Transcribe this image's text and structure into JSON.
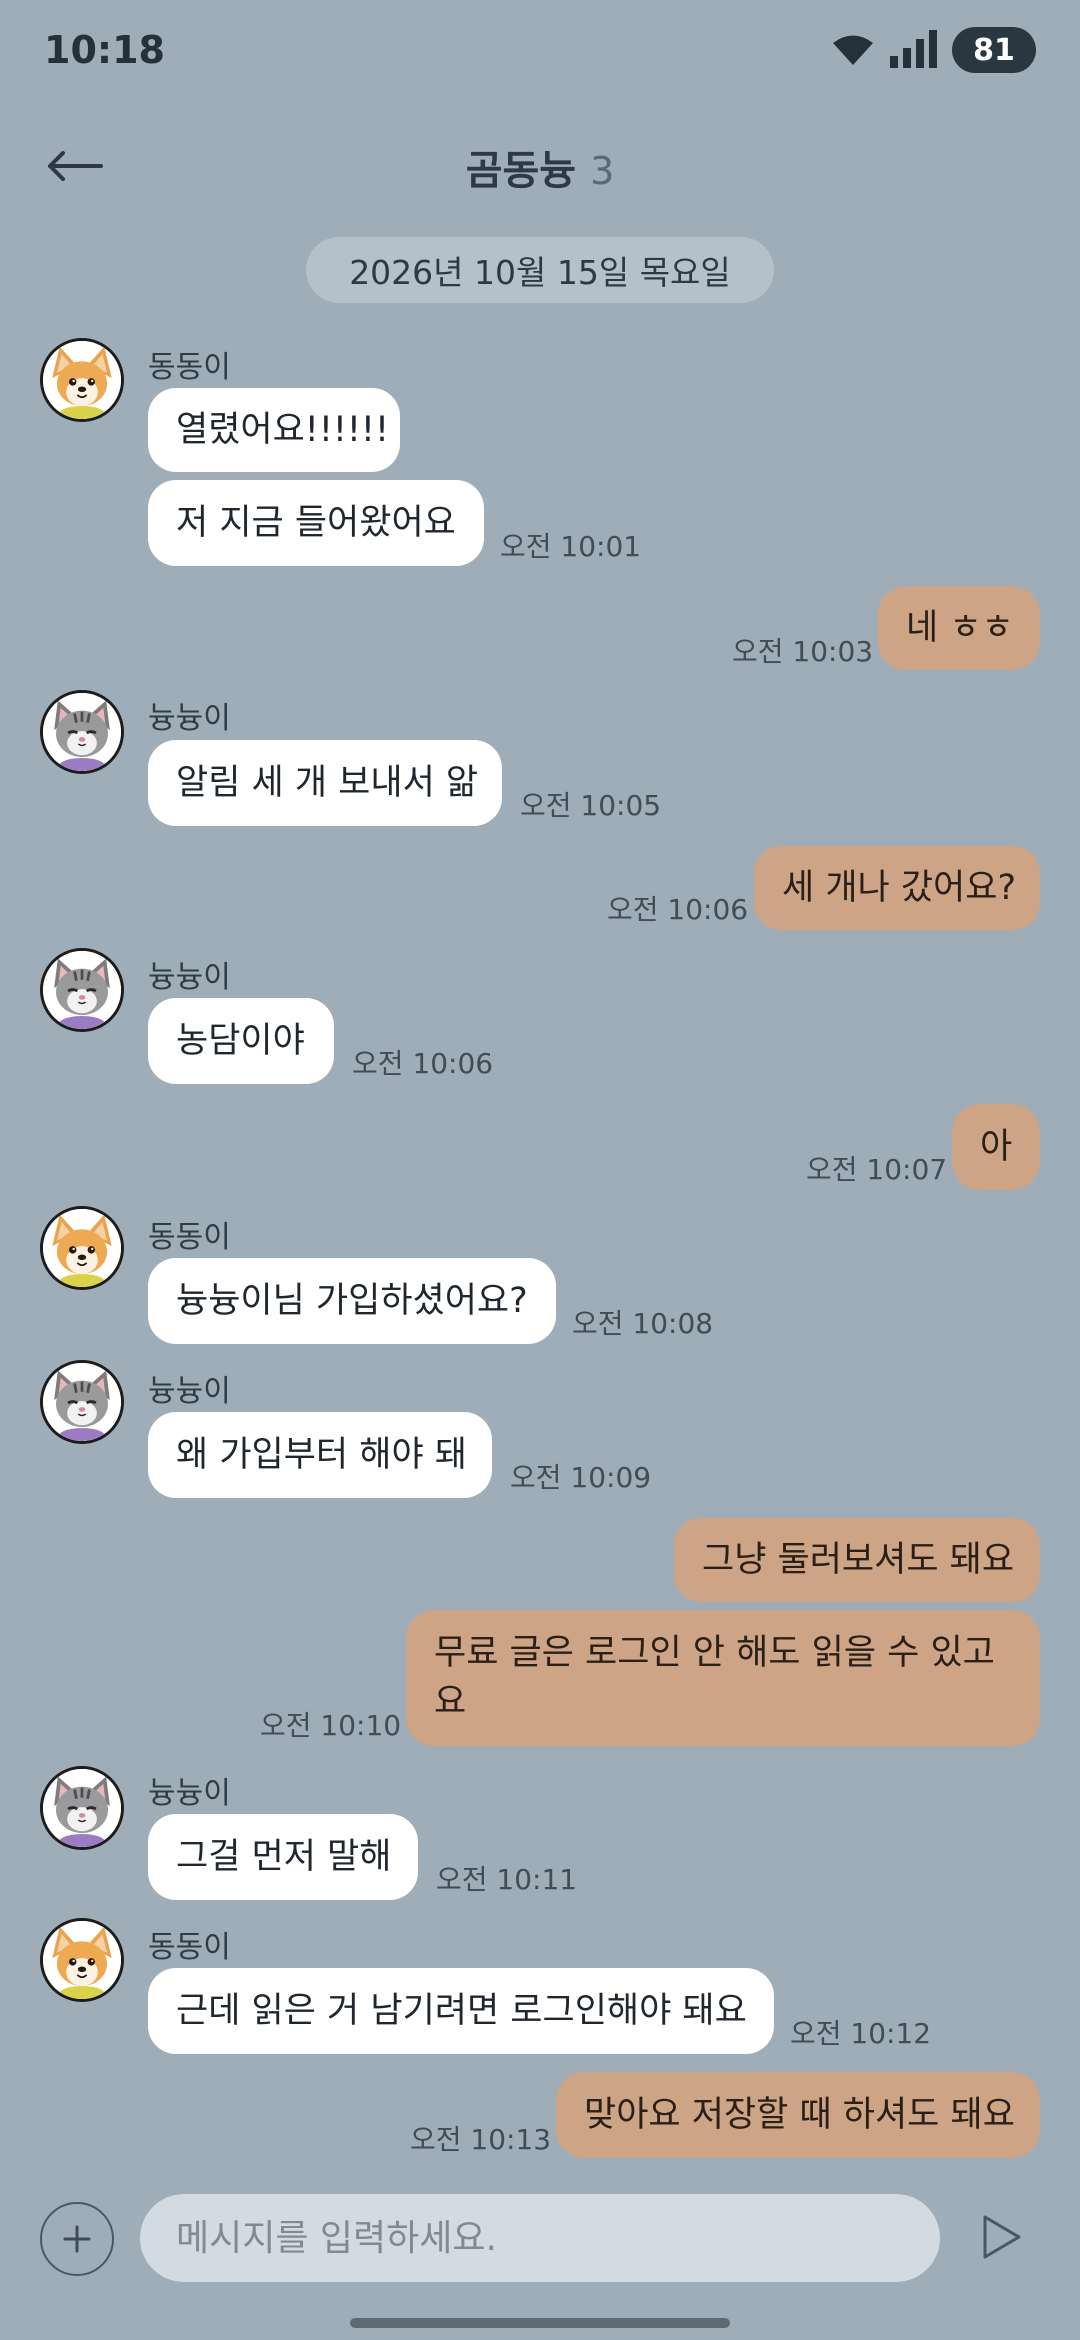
{
  "status_bar": {
    "time": "10:18",
    "battery": "81",
    "icons": [
      "wifi-icon",
      "signal-icon",
      "battery-icon"
    ]
  },
  "header": {
    "title": "곰동늉",
    "count": "3",
    "back_icon": "arrow-left-icon"
  },
  "date_divider": "2026년 10월 15일 목요일",
  "senders": {
    "dog": "동동이",
    "cat": "늉늉이"
  },
  "messages": [
    {
      "text": "열렸어요!!!!!!",
      "time": ""
    },
    {
      "text": "저 지금 들어왔어요",
      "time": "오전 10:01"
    },
    {
      "text": "네 ㅎㅎ",
      "time": "오전 10:03"
    },
    {
      "text": "알림 세 개 보내서 앎",
      "time": "오전 10:05"
    },
    {
      "text": "세 개나 갔어요?",
      "time": "오전 10:06"
    },
    {
      "text": "농담이야",
      "time": "오전 10:06"
    },
    {
      "text": "아",
      "time": "오전 10:07"
    },
    {
      "text": "늉늉이님 가입하셨어요?",
      "time": "오전 10:08"
    },
    {
      "text": "왜 가입부터 해야 돼",
      "time": "오전 10:09"
    },
    {
      "text": "그냥 둘러보셔도 돼요",
      "time": ""
    },
    {
      "text": "무료 글은 로그인 안 해도 읽을 수 있고요",
      "time": "오전 10:10"
    },
    {
      "text": "그걸 먼저 말해",
      "time": "오전 10:11"
    },
    {
      "text": "근데 읽은 거 남기려면 로그인해야 돼요",
      "time": "오전 10:12"
    },
    {
      "text": "맞아요 저장할 때 하셔도 돼요",
      "time": "오전 10:13"
    }
  ],
  "input": {
    "placeholder": "메시지를 입력하세요.",
    "value": ""
  },
  "colors": {
    "background": "#9eadb8",
    "incoming_bubble": "#ffffff",
    "outgoing_bubble": "#cda486",
    "date_pill": "#b5c1ca",
    "input_field": "#d2dbe1"
  }
}
